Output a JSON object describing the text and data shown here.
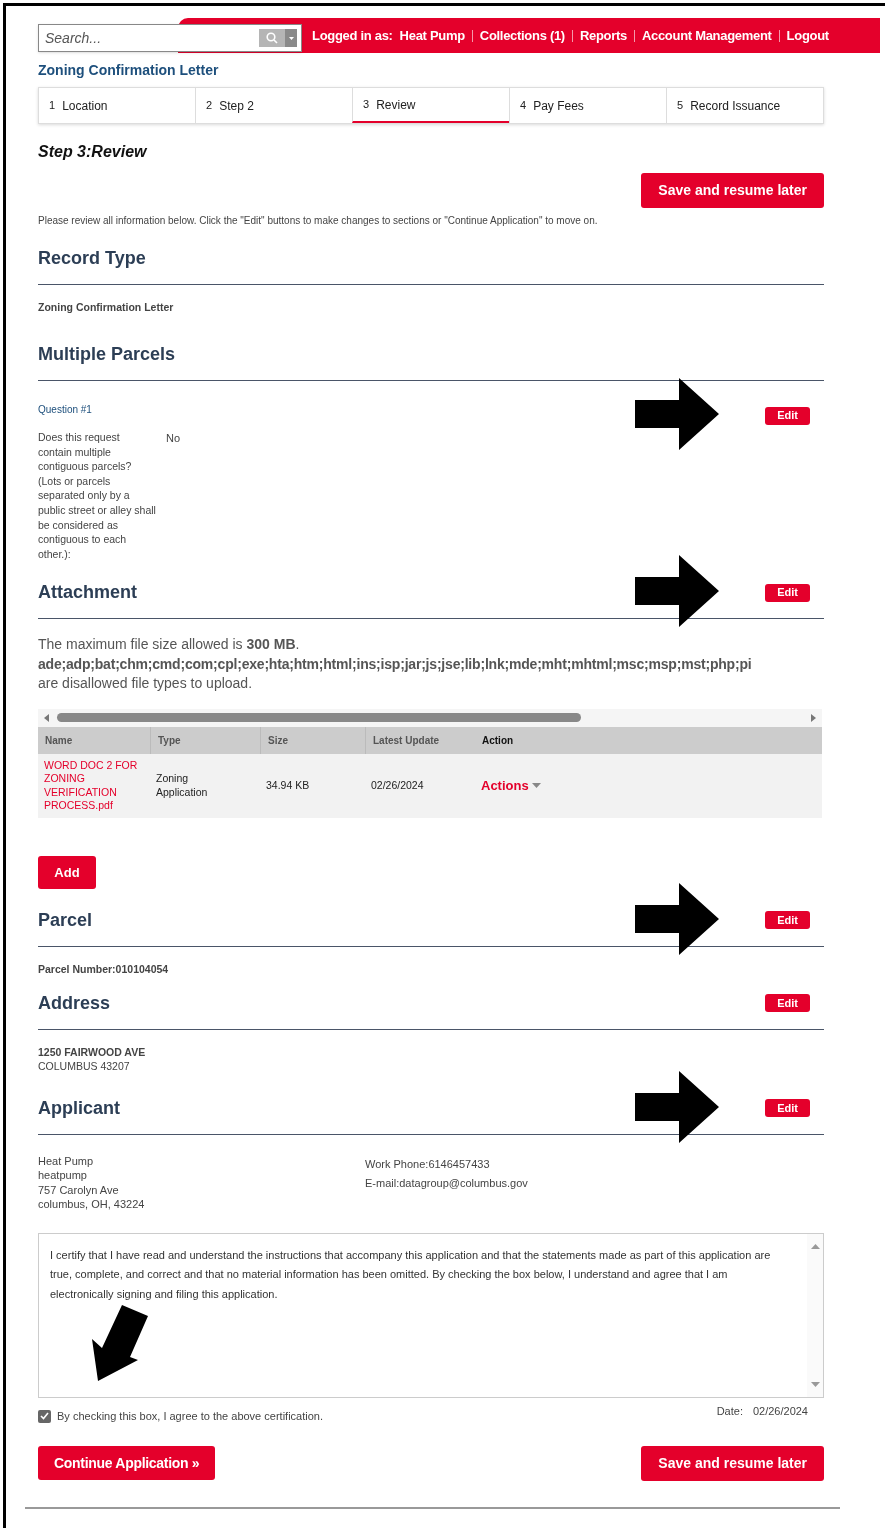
{
  "top_bar": {
    "search": {
      "placeholder": "Search..."
    },
    "logged_in_label": "Logged in as:",
    "user_name": "Heat Pump",
    "links": [
      "Collections (1)",
      "Reports",
      "Account Management",
      "Logout"
    ]
  },
  "page_title": "Zoning Confirmation Letter",
  "steps": [
    {
      "number": "1",
      "label": "Location",
      "selected": false
    },
    {
      "number": "2",
      "label": "Step 2",
      "selected": false
    },
    {
      "number": "3",
      "label": "Review",
      "selected": true
    },
    {
      "number": "4",
      "label": "Pay Fees",
      "selected": false
    },
    {
      "number": "5",
      "label": "Record Issuance",
      "selected": false
    }
  ],
  "step_heading": "Step 3:Review",
  "save_button": "Save and resume later",
  "instructions": "Please review all information below. Click the \"Edit\" buttons to make changes to sections or \"Continue Application\" to move on.",
  "sections": [
    {
      "kind": "text",
      "title": "Record Type",
      "lines": [
        "Zoning Confirmation Letter"
      ]
    },
    {
      "kind": "question",
      "title": "Multiple Parcels",
      "edit_button": "Edit",
      "annotated": true,
      "question_label": "Question #1",
      "question": "Does this request contain multiple contiguous parcels? (Lots or parcels separated only by a public street or alley shall be considered as contiguous to each other.):",
      "answer": "No"
    },
    {
      "kind": "attachment",
      "title": "Attachment",
      "edit_button": "Edit",
      "annotated": true,
      "notice": [
        "The maximum file size allowed is **300 MB**.",
        "ade;adp;bat;chm;cmd;com;cpl;exe;hta;htm;html;ins;isp;jar;js;jse;lib;lnk;mde;mht;mhtml;msc;msp;mst;php;pi",
        "are disallowed file types to upload."
      ],
      "columns": [
        "Name",
        "Type",
        "Size",
        "Latest Update",
        "Action"
      ],
      "rows": [
        {
          "name": "WORD DOC 2 FOR ZONING VERIFICATION PROCESS.pdf",
          "type": "Zoning Application",
          "size": "34.94 KB",
          "updated": "02/26/2024",
          "action": "Actions"
        }
      ],
      "add_button": "Add"
    },
    {
      "kind": "text",
      "title": "Parcel",
      "edit_button": "Edit",
      "annotated": true,
      "lines": [
        "Parcel Number:010104054"
      ]
    },
    {
      "kind": "text",
      "title": "Address",
      "edit_button": "Edit",
      "lines": [
        "1250 FAIRWOOD AVE",
        "COLUMBUS 43207"
      ]
    },
    {
      "kind": "contact",
      "title": "Applicant",
      "edit_button": "Edit",
      "annotated": true,
      "left": [
        "Heat Pump",
        "heatpump",
        "757 Carolyn Ave",
        "columbus, OH, 43224"
      ],
      "right": [
        "Work Phone:6146457433",
        "E-mail:datagroup@columbus.gov"
      ]
    }
  ],
  "certification": {
    "text": "I certify that I have read and understand the instructions that accompany this application and that the statements made as part of this application are true, complete, and correct and that no material information has been omitted. By checking the box below, I understand and agree that I am electronically signing and filing this application.",
    "annotated": true,
    "checkbox_label": "By checking this box, I agree to the above certification.",
    "checked": true,
    "date_label": "Date:",
    "date": "02/26/2024"
  },
  "continue_button": "Continue Application »",
  "bottom_save_button": "Save and resume later"
}
